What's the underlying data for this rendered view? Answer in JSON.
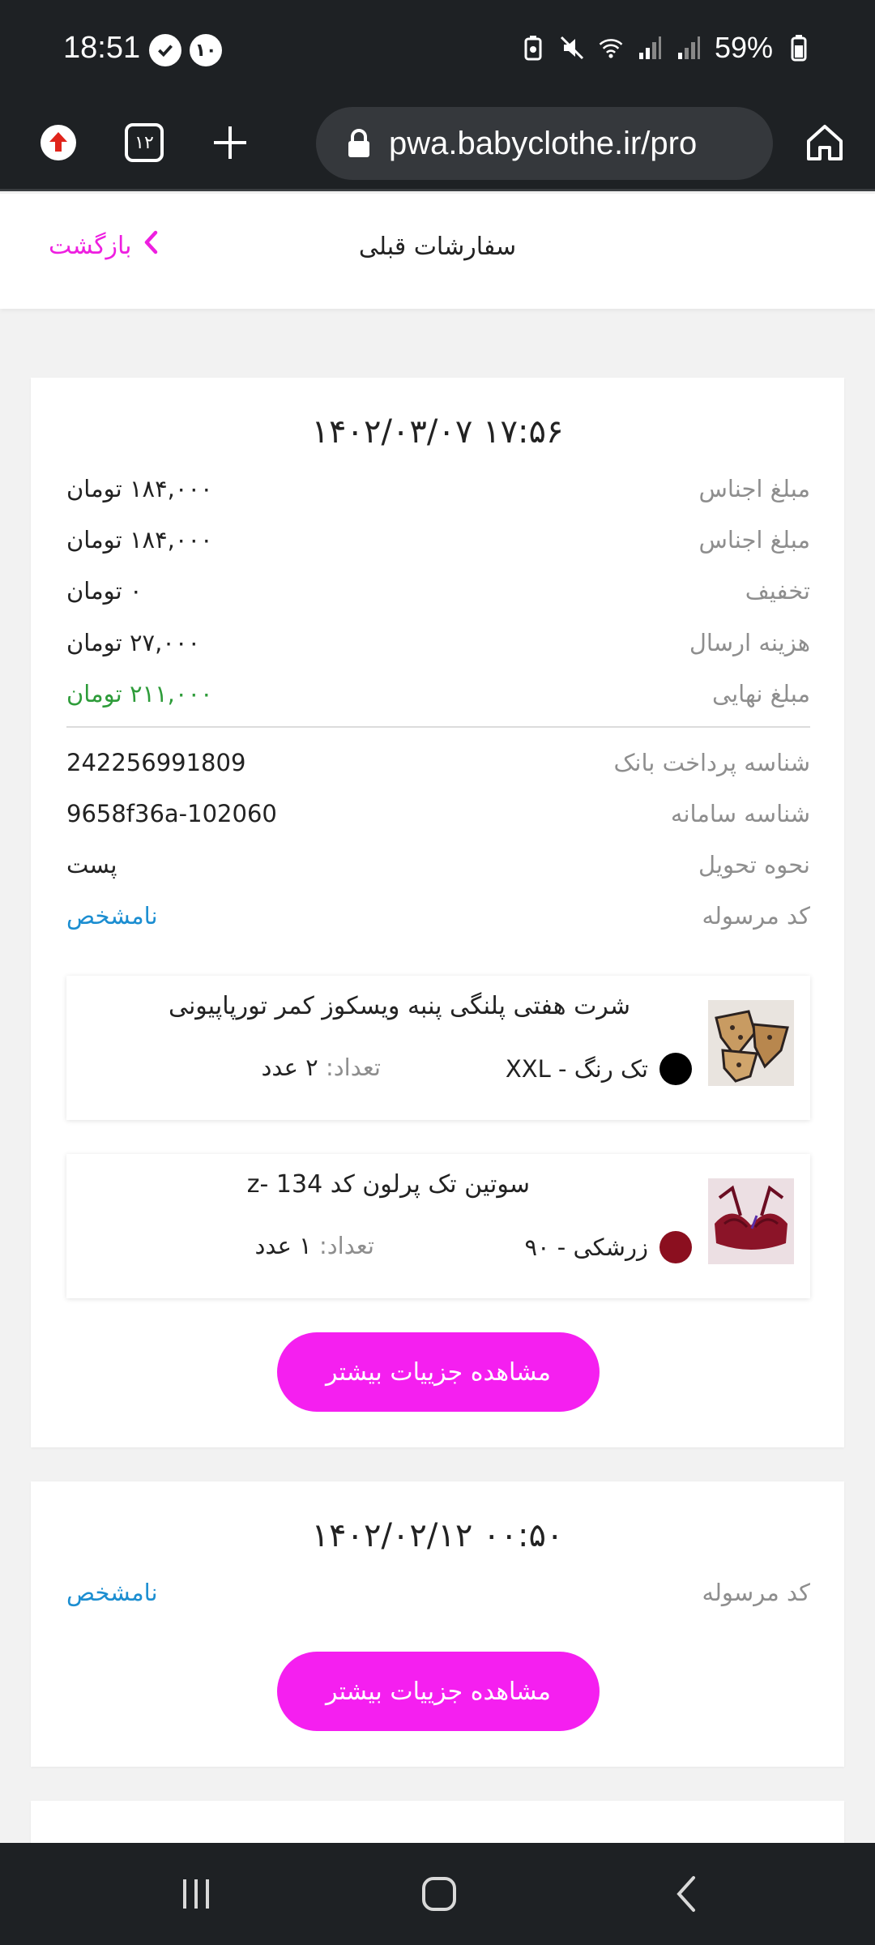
{
  "status_bar": {
    "time": "18:51",
    "notification_count": "۱۰",
    "battery": "59%"
  },
  "browser": {
    "tab_count": "۱۲",
    "url": "pwa.babyclothe.ir/pro"
  },
  "header": {
    "title": "سفارشات قبلی",
    "back_label": "بازگشت"
  },
  "colors": {
    "accent": "#f51ff0",
    "price_final": "#2e9c3a",
    "tracking_link": "#1c8ed1"
  },
  "orders": [
    {
      "date": "۱۴۰۲/۰۳/۰۷ ۱۷:۵۶",
      "rows": [
        {
          "label": "مبلغ اجناس",
          "value": "۱۸۴,۰۰۰ تومان"
        },
        {
          "label": "مبلغ اجناس",
          "value": "۱۸۴,۰۰۰ تومان"
        },
        {
          "label": "تخفیف",
          "value": "۰ تومان"
        },
        {
          "label": "هزینه ارسال",
          "value": "۲۷,۰۰۰ تومان"
        },
        {
          "label": "مبلغ نهایی",
          "value": "۲۱۱,۰۰۰ تومان"
        }
      ],
      "meta": [
        {
          "label": "شناسه پرداخت بانک",
          "value": "242256991809"
        },
        {
          "label": "شناسه سامانه",
          "value": "9658f36a-102060"
        },
        {
          "label": "نحوه تحویل",
          "value": "پست"
        },
        {
          "label": "کد مرسوله",
          "value": "نامشخص"
        }
      ],
      "items": [
        {
          "name": "شرت هفتی پلنگی پنبه ویسکوز کمر تورپاپیونی",
          "color_label": "تک رنگ",
          "size": "XXL",
          "color": "#000000",
          "qty_label": "تعداد:",
          "qty_value": "۲ عدد"
        },
        {
          "name": "سوتین تک پرلون کد 134 -z",
          "color_label": "زرشکی",
          "size": "۹۰",
          "color": "#8b0f1f",
          "qty_label": "تعداد:",
          "qty_value": "۱ عدد"
        }
      ],
      "details_button": "مشاهده جزییات بیشتر"
    },
    {
      "date": "۱۴۰۲/۰۲/۱۲ ۰۰:۵۰",
      "meta": [
        {
          "label": "کد مرسوله",
          "value": "نامشخص"
        }
      ],
      "details_button": "مشاهده جزییات بیشتر"
    }
  ]
}
